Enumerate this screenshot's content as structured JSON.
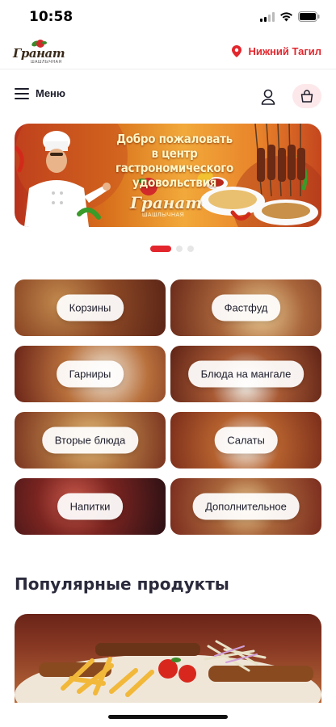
{
  "status": {
    "time": "10:58"
  },
  "brand": {
    "logo_text": "Гранат",
    "logo_sub": "ШАШЛЫЧНАЯ",
    "city": "Нижний Тагил"
  },
  "nav": {
    "menu_label": "Меню"
  },
  "banner": {
    "line1": "Добро пожаловать",
    "line2": "в центр гастрономического",
    "line3": "удовольствия",
    "logo_text": "Гранат",
    "logo_sub": "ШАШЛЫЧНАЯ"
  },
  "carousel": {
    "slides": 3,
    "active": 1
  },
  "categories": [
    {
      "label": "Корзины"
    },
    {
      "label": "Фастфуд"
    },
    {
      "label": "Гарниры"
    },
    {
      "label": "Блюда на мангале"
    },
    {
      "label": "Вторые блюда"
    },
    {
      "label": "Салаты"
    },
    {
      "label": "Напитки"
    },
    {
      "label": "Дополнительное"
    }
  ],
  "popular": {
    "title": "Популярные продукты"
  },
  "colors": {
    "accent": "#e3262d",
    "cart_bg": "#fce8ea",
    "text": "#1d1d2b"
  },
  "icons": {
    "location": "map-pin-icon",
    "user": "user-icon",
    "cart": "basket-icon",
    "menu": "hamburger-icon"
  }
}
